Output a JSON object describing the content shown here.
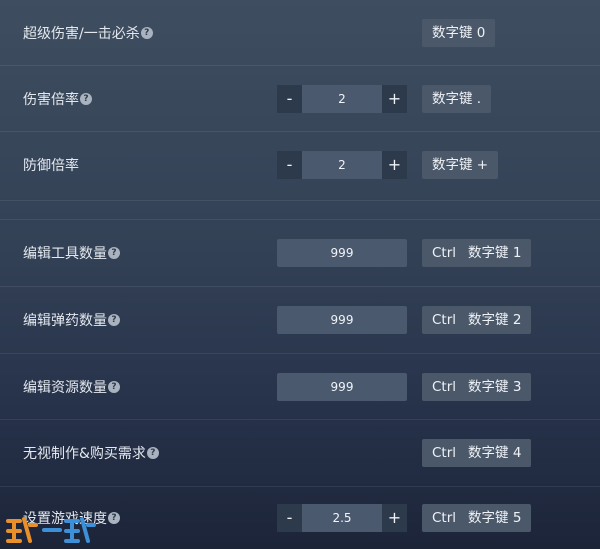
{
  "rows": [
    {
      "label": "超级伤害/一击必杀",
      "hotkey": "数字键 0"
    },
    {
      "label": "伤害倍率",
      "value": "2",
      "minus": "-",
      "plus": "+",
      "hotkey": "数字键 ."
    },
    {
      "label": "防御倍率",
      "value": "2",
      "minus": "-",
      "plus": "+",
      "hotkey": "数字键 +"
    },
    {
      "label": "编辑工具数量",
      "value": "999",
      "ctrl": "Ctrl",
      "hotkey": "数字键 1"
    },
    {
      "label": "编辑弹药数量",
      "value": "999",
      "ctrl": "Ctrl",
      "hotkey": "数字键 2"
    },
    {
      "label": "编辑资源数量",
      "value": "999",
      "ctrl": "Ctrl",
      "hotkey": "数字键 3"
    },
    {
      "label": "无视制作&购买需求",
      "ctrl": "Ctrl",
      "hotkey": "数字键 4"
    },
    {
      "label": "设置游戏速度",
      "value": "2.5",
      "minus": "-",
      "plus": "+",
      "ctrl": "Ctrl",
      "hotkey": "数字键 5"
    }
  ],
  "help_glyph": "?",
  "watermark": "玩一玩",
  "colors": {
    "background_top": "#3f4d60",
    "background_bottom": "#1c2438",
    "key_bg": "#4b586a",
    "field_bg": "#4a596d",
    "watermark_orange": "#e8902a",
    "watermark_blue": "#3d8fd8"
  }
}
